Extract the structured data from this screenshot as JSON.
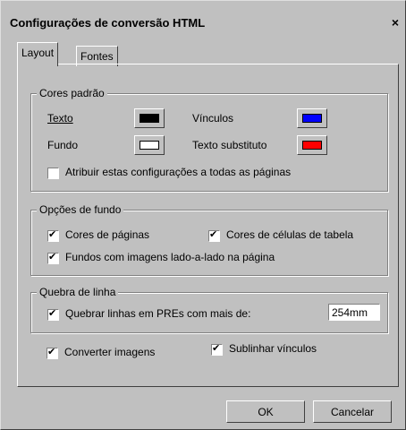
{
  "window": {
    "title": "Configurações de conversão HTML",
    "close": "×"
  },
  "tabs": [
    {
      "label": "Layout",
      "active": true
    },
    {
      "label": "Fontes",
      "active": false
    }
  ],
  "cores_padrao": {
    "legend": "Cores padrão",
    "texto_label": "Texto",
    "vinculos_label": "Vínculos",
    "fundo_label": "Fundo",
    "texto_substituto_label": "Texto substituto",
    "colors": {
      "texto": "#000000",
      "vinculos": "#0000ff",
      "fundo": "#ffffff",
      "texto_substituto": "#ff0000"
    },
    "atribuir": {
      "label": "Atribuir estas configurações a todas as páginas",
      "checked": false
    }
  },
  "opcoes_fundo": {
    "legend": "Opções de fundo",
    "cores_paginas": {
      "label": "Cores de páginas",
      "checked": true
    },
    "cores_celulas": {
      "label": "Cores de células de tabela",
      "checked": true
    },
    "fundos_imagens": {
      "label": "Fundos com imagens lado-a-lado na página",
      "checked": true
    }
  },
  "quebra_linha": {
    "legend": "Quebra de linha",
    "quebrar": {
      "label": "Quebrar linhas em PREs com mais de:",
      "checked": true
    },
    "value": "254mm"
  },
  "converter_imagens": {
    "label": "Converter imagens",
    "checked": true
  },
  "sublinhar_vinculos": {
    "label": "Sublinhar vínculos",
    "checked": true
  },
  "buttons": {
    "ok": "OK",
    "cancelar": "Cancelar"
  }
}
